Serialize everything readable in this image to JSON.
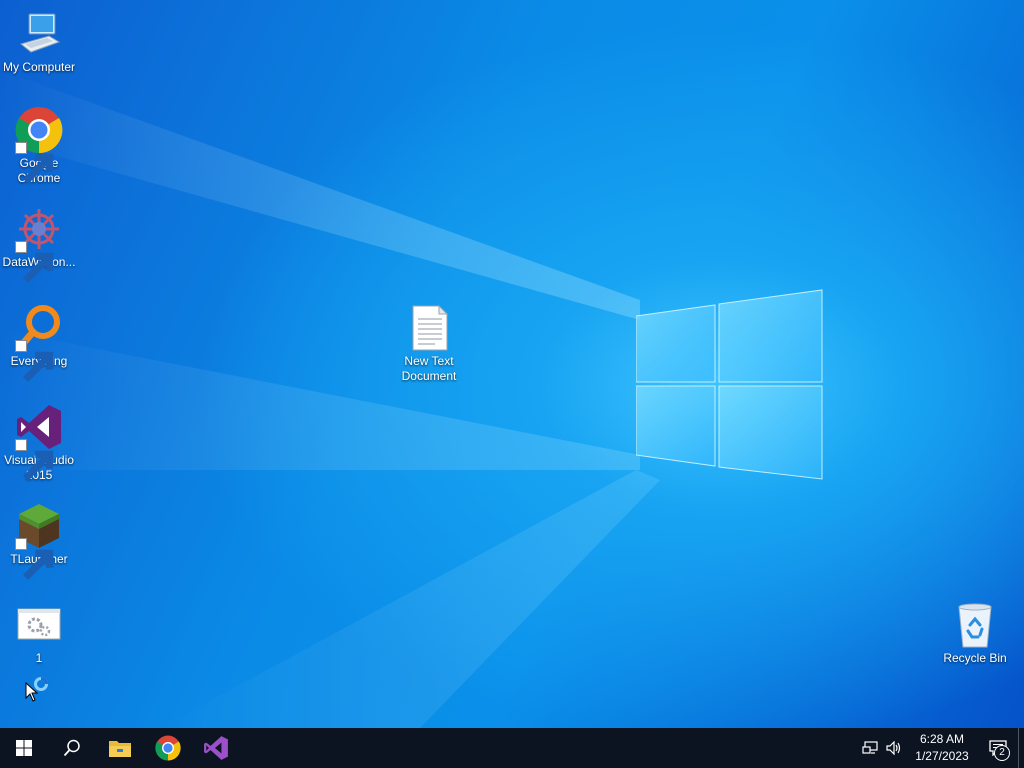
{
  "desktop": {
    "icons": [
      {
        "label": "My Computer",
        "icon": "computer-icon"
      },
      {
        "label": "Google Chrome",
        "icon": "chrome-icon"
      },
      {
        "label": "DataWagon...",
        "icon": "datawagon-icon"
      },
      {
        "label": "Everything",
        "icon": "everything-icon"
      },
      {
        "label": "Visual Studio 2015",
        "icon": "visual-studio-icon"
      },
      {
        "label": "TLauncher",
        "icon": "tlauncher-icon"
      },
      {
        "label": "1",
        "icon": "settings-window-icon"
      },
      {
        "label": "New Text Document",
        "icon": "text-document-icon"
      },
      {
        "label": "Recycle Bin",
        "icon": "recycle-bin-icon"
      }
    ]
  },
  "taskbar": {
    "start_icon": "windows-start-icon",
    "search_icon": "search-icon",
    "pinned": [
      "file-explorer-icon",
      "chrome-icon",
      "visual-studio-icon"
    ],
    "tray": {
      "network_icon": "network-icon",
      "volume_icon": "volume-icon",
      "time": "6:28 AM",
      "date": "1/27/2023",
      "notification_count": "2"
    }
  },
  "colors": {
    "taskbar_bg": "#0c1422",
    "wallpaper_accent": "#18a4f2"
  }
}
